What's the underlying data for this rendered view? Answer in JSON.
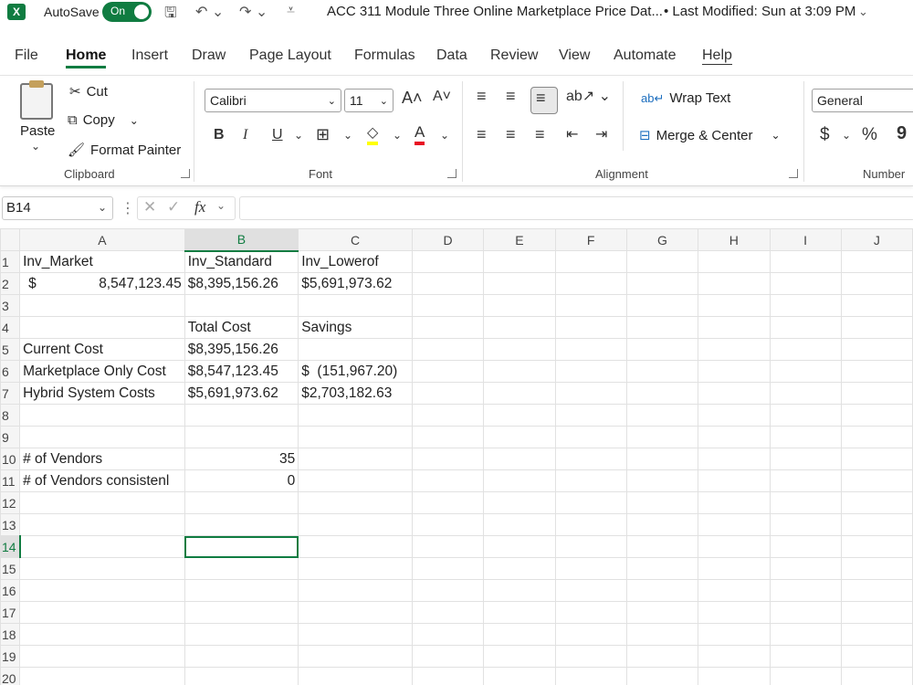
{
  "titlebar": {
    "autosave_label": "AutoSave",
    "autosave_state": "On",
    "document_title": "ACC 311 Module Three Online Marketplace Price Dat...",
    "modified": "• Last Modified: Sun at 3:09 PM"
  },
  "menu": {
    "tabs": [
      "File",
      "Home",
      "Insert",
      "Draw",
      "Page Layout",
      "Formulas",
      "Data",
      "Review",
      "View",
      "Automate",
      "Help"
    ],
    "active": "Home"
  },
  "ribbon": {
    "clipboard": {
      "paste": "Paste",
      "cut": "Cut",
      "copy": "Copy",
      "format_painter": "Format Painter",
      "label": "Clipboard"
    },
    "font": {
      "family": "Calibri",
      "size": "11",
      "bold": "B",
      "italic": "I",
      "underline": "U",
      "label": "Font"
    },
    "alignment": {
      "wrap_text": "Wrap Text",
      "merge_center": "Merge & Center",
      "label": "Alignment"
    },
    "number": {
      "format": "General",
      "currency": "$",
      "percent": "%",
      "label": "Number"
    }
  },
  "formula_bar": {
    "name_box": "B14",
    "fx": "fx",
    "formula": ""
  },
  "grid": {
    "columns": [
      "A",
      "B",
      "C",
      "D",
      "E",
      "F",
      "G",
      "H",
      "I",
      "J"
    ],
    "selected_column": "B",
    "selected_row": "14",
    "rows": [
      {
        "n": "1",
        "a": "Inv_Market",
        "b": "Inv_Standard",
        "c": "Inv_Lowerof"
      },
      {
        "n": "2",
        "a_cur": "$",
        "a_val": "8,547,123.45",
        "b": "$8,395,156.26",
        "c": "$5,691,973.62"
      },
      {
        "n": "3"
      },
      {
        "n": "4",
        "b": "Total Cost",
        "c": "Savings"
      },
      {
        "n": "5",
        "a": "Current Cost",
        "b": "$8,395,156.26"
      },
      {
        "n": "6",
        "a": "Marketplace Only Cost",
        "b": "$8,547,123.45",
        "c": "$  (151,967.20)"
      },
      {
        "n": "7",
        "a": "Hybrid System Costs",
        "b": "$5,691,973.62",
        "c": "$2,703,182.63"
      },
      {
        "n": "8"
      },
      {
        "n": "9"
      },
      {
        "n": "10",
        "a": "# of Vendors",
        "b_num": "35"
      },
      {
        "n": "11",
        "a": "# of Vendors consistenl",
        "b_num": "0"
      },
      {
        "n": "12"
      },
      {
        "n": "13"
      },
      {
        "n": "14"
      },
      {
        "n": "15"
      },
      {
        "n": "16"
      },
      {
        "n": "17"
      },
      {
        "n": "18"
      },
      {
        "n": "19"
      },
      {
        "n": "20"
      }
    ]
  },
  "colors": {
    "accent": "#107c41"
  }
}
